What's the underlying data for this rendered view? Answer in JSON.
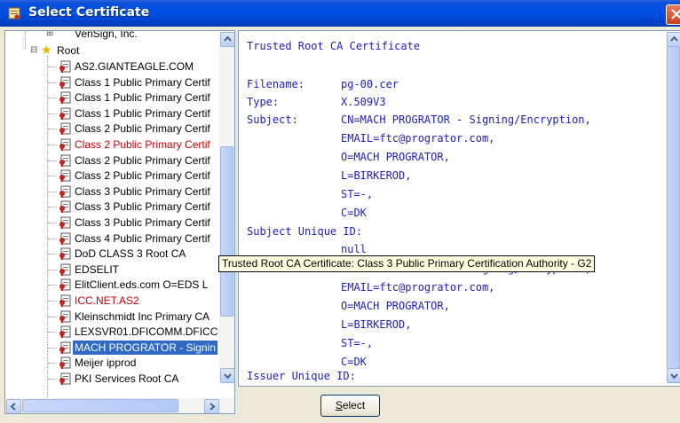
{
  "window": {
    "title": "Select Certificate",
    "title_icon": "certificate-app-icon"
  },
  "tree": {
    "root_sibling": "VeriSign, Inc.",
    "root_label": "Root",
    "items": [
      {
        "label": "AS2.GIANTEAGLE.COM",
        "state": "normal"
      },
      {
        "label": "Class 1 Public Primary Certif",
        "state": "normal"
      },
      {
        "label": "Class 1 Public Primary Certif",
        "state": "normal"
      },
      {
        "label": "Class 1 Public Primary Certif",
        "state": "normal"
      },
      {
        "label": "Class 2 Public Primary Certif",
        "state": "normal"
      },
      {
        "label": "Class 2 Public Primary Certif",
        "state": "red"
      },
      {
        "label": "Class 2 Public Primary Certif",
        "state": "normal"
      },
      {
        "label": "Class 2 Public Primary Certif",
        "state": "normal"
      },
      {
        "label": "Class 3 Public Primary Certif",
        "state": "normal"
      },
      {
        "label": "Class 3 Public Primary Certif",
        "state": "normal"
      },
      {
        "label": "Class 3 Public Primary Certif",
        "state": "normal"
      },
      {
        "label": "Class 4 Public Primary Certif",
        "state": "normal"
      },
      {
        "label": "DoD CLASS 3 Root CA",
        "state": "normal"
      },
      {
        "label": "EDSELIT",
        "state": "normal"
      },
      {
        "label": "ElitClient.eds.com O=EDS L",
        "state": "normal"
      },
      {
        "label": "ICC.NET.AS2",
        "state": "red"
      },
      {
        "label": "Kleinschmidt Inc Primary CA",
        "state": "normal"
      },
      {
        "label": "LEXSVR01.DFICOMM.DFICC",
        "state": "normal"
      },
      {
        "label": "MACH PROGRATOR - Signin",
        "state": "selected"
      },
      {
        "label": "Meijer ipprod",
        "state": "normal"
      },
      {
        "label": "PKI Services Root CA",
        "state": "normal"
      }
    ]
  },
  "details": {
    "heading": "Trusted Root CA Certificate",
    "filename_label": "Filename:",
    "filename": "pg-00.cer",
    "type_label": "Type:",
    "type": "X.509V3",
    "subject_label": "Subject:",
    "subject": [
      "CN=MACH PROGRATOR - Signing/Encryption,",
      "EMAIL=ftc@progrator.com,",
      "O=MACH PROGRATOR,",
      "L=BIRKEROD,",
      "ST=-,",
      "C=DK"
    ],
    "subject_uid_label": "Subject Unique ID:",
    "subject_uid": "null",
    "issuer_label": "Issuer:",
    "issuer": [
      "CN=MACH PROGRATOR - Signing/Encryption,",
      "EMAIL=ftc@progrator.com,",
      "O=MACH PROGRATOR,",
      "L=BIRKEROD,",
      "ST=-,",
      "C=DK"
    ],
    "issuer_uid_label": "Issuer Unique ID:"
  },
  "tooltip": "Trusted Root CA Certificate: Class 3 Public Primary Certification Authority - G2",
  "buttons": {
    "select": "Select",
    "select_mnemonic": "S",
    "select_rest": "elect"
  }
}
